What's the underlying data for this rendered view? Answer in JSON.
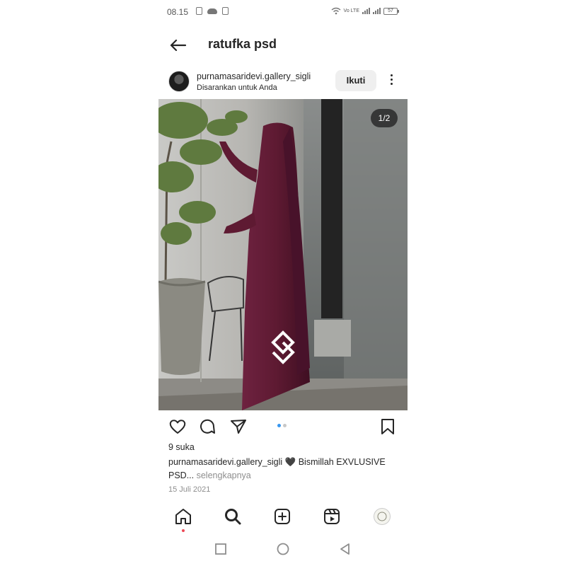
{
  "status_bar": {
    "time": "08.15",
    "network_label": "Vo LTE",
    "battery": "57"
  },
  "header": {
    "title": "ratufka psd",
    "back_icon": "arrow-left-icon"
  },
  "post": {
    "username": "purnamasaridevi.gallery_sigli",
    "subtitle": "Disarankan untuk Anda",
    "follow_label": "Ikuti",
    "media_counter": "1/2",
    "likes": "9 suka",
    "caption_username": "purnamasaridevi.gallery_sigli",
    "caption_text": "🖤 Bismillah EXVLUSIVE PSD...",
    "more_label": "selengkapnya",
    "date": "15 Juli 2021"
  },
  "icons": {
    "like": "heart-icon",
    "comment": "comment-icon",
    "share": "send-icon",
    "save": "bookmark-icon",
    "home": "home-icon",
    "search": "search-icon",
    "create": "plus-square-icon",
    "reels": "reels-icon",
    "profile": "profile-avatar"
  },
  "colors": {
    "accent": "#3897f0",
    "text": "#262626",
    "muted": "#8e8e8e",
    "notification": "#ed4956",
    "dress": "#5e1a32"
  }
}
